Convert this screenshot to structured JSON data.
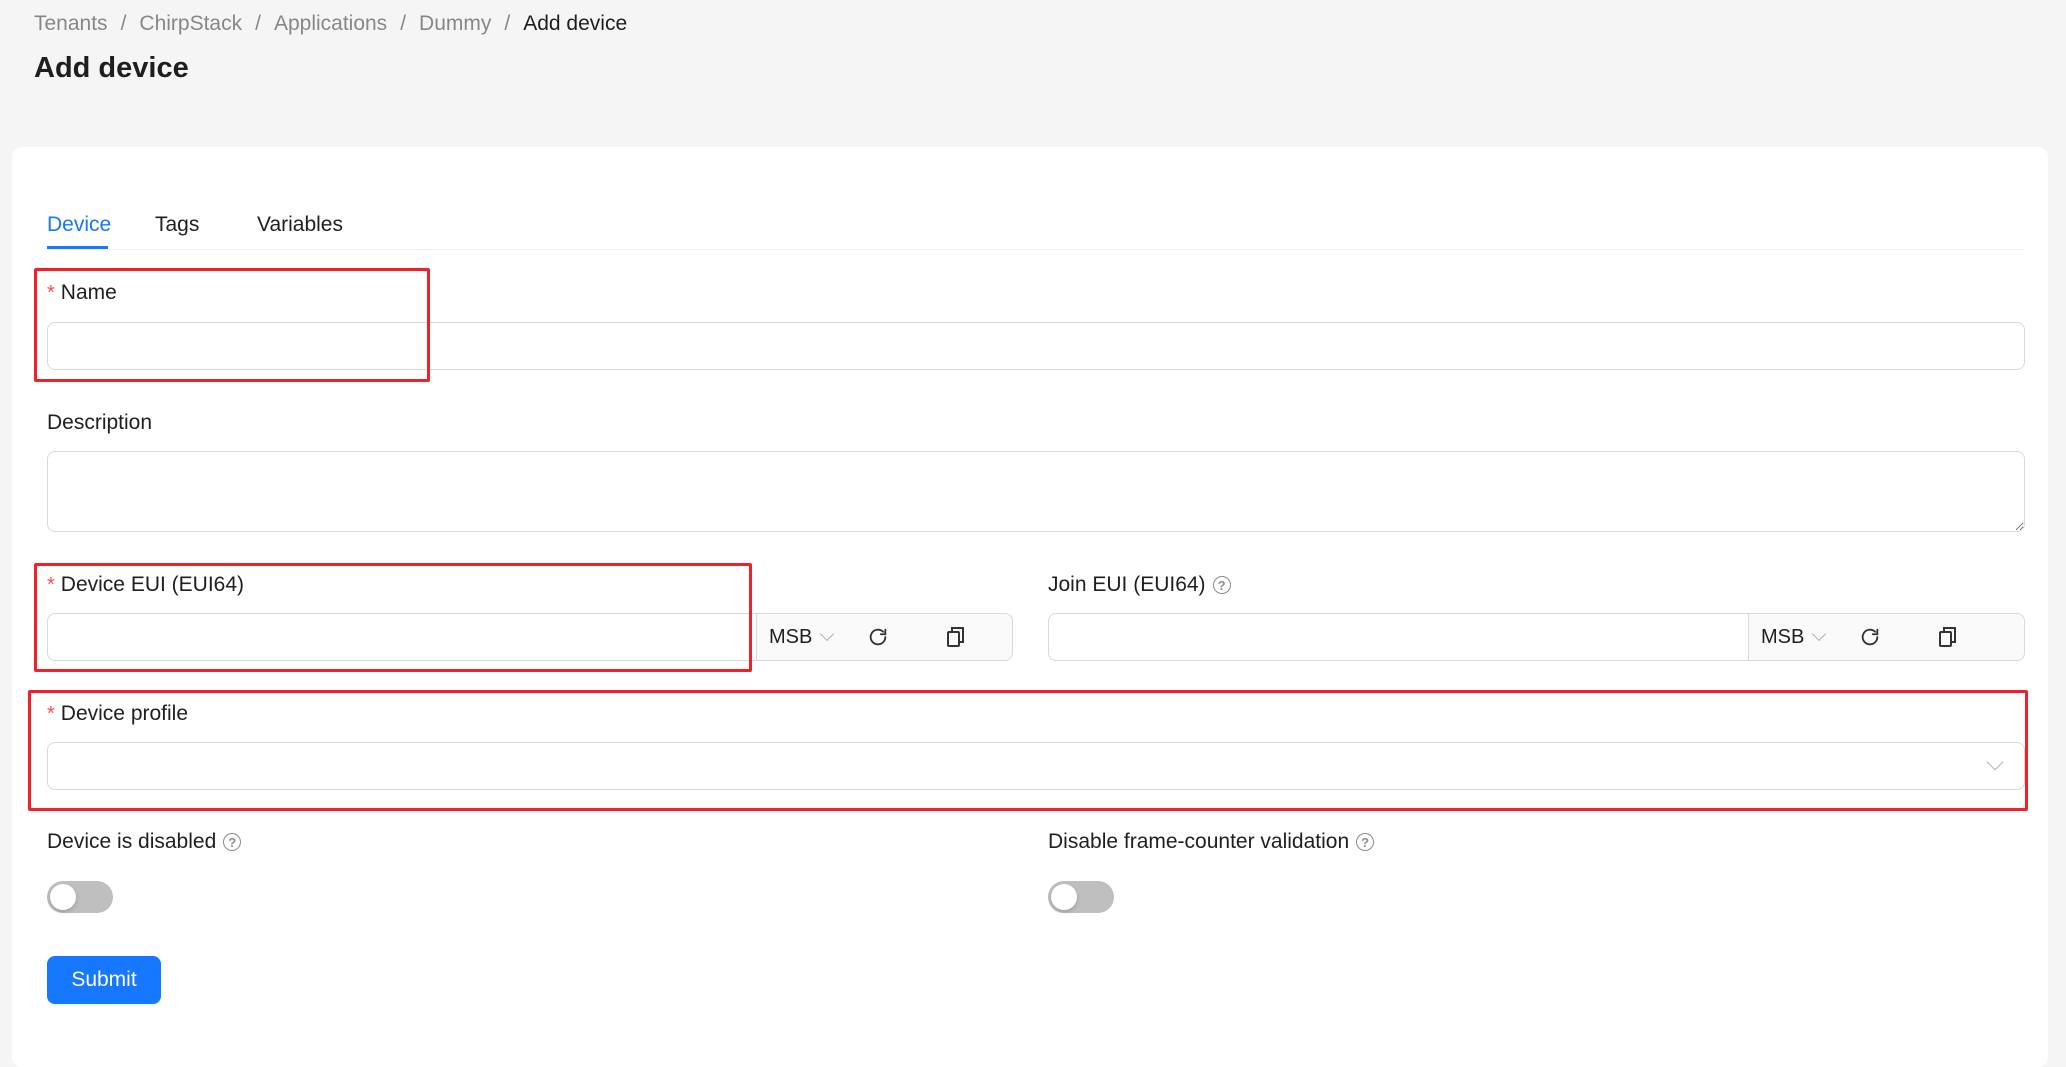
{
  "breadcrumb": {
    "items": [
      "Tenants",
      "ChirpStack",
      "Applications",
      "Dummy"
    ],
    "current": "Add device",
    "separator": "/"
  },
  "page_title": "Add device",
  "tabs": [
    {
      "label": "Device",
      "active": true
    },
    {
      "label": "Tags",
      "active": false
    },
    {
      "label": "Variables",
      "active": false
    }
  ],
  "form": {
    "name": {
      "label": "Name",
      "required": true,
      "value": ""
    },
    "description": {
      "label": "Description",
      "value": ""
    },
    "device_eui": {
      "label": "Device EUI (EUI64)",
      "required": true,
      "value": "",
      "byte_order": "MSB"
    },
    "join_eui": {
      "label": "Join EUI (EUI64)",
      "value": "",
      "byte_order": "MSB"
    },
    "device_profile": {
      "label": "Device profile",
      "required": true,
      "value": ""
    },
    "device_disabled": {
      "label": "Device is disabled",
      "on": false
    },
    "skip_fcnt_check": {
      "label": "Disable frame-counter validation",
      "on": false
    },
    "submit_label": "Submit"
  },
  "icons": {
    "help": "question-circle-icon",
    "refresh": "reload-icon",
    "copy": "copy-icon",
    "dropdown": "chevron-down-icon"
  },
  "colors": {
    "primary": "#1677ff",
    "required": "#ff4d4f",
    "highlight": "#f0212b",
    "page_bg": "#f5f5f5"
  }
}
